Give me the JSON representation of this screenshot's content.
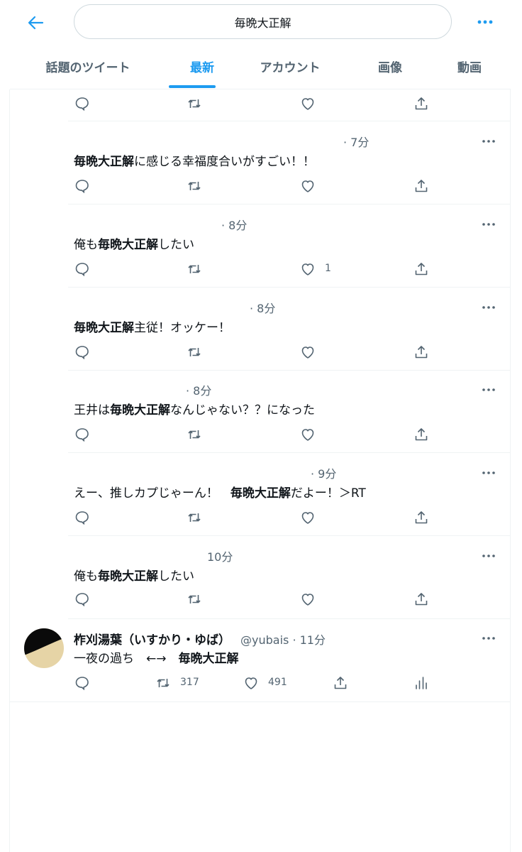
{
  "search": {
    "query": "毎晩大正解"
  },
  "tabs": [
    {
      "label": "話題のツイート"
    },
    {
      "label": "最新"
    },
    {
      "label": "アカウント"
    },
    {
      "label": "画像"
    },
    {
      "label": "動画"
    }
  ],
  "replies": [
    {
      "time": "· 7分",
      "text_bold": "毎晩大正解",
      "text_after": "に感じる幸福度合いがすごい！！"
    },
    {
      "time": "· 8分",
      "text_before": "俺も",
      "text_bold": "毎晩大正解",
      "text_after": "したい",
      "like_count": "1"
    },
    {
      "time": "· 8分",
      "text_bold": "毎晩大正解",
      "text_after": "主従！オッケー！"
    },
    {
      "time": "· 8分",
      "text_before": "王井は",
      "text_bold": "毎晩大正解",
      "text_after": "なんじゃない？？になった"
    },
    {
      "time": "· 9分",
      "text_before": "えー、推しカプじゃーん！　",
      "text_bold": "毎晩大正解",
      "text_after": "だよー！＞RT"
    },
    {
      "time": "10分",
      "text_before": "俺も",
      "text_bold": "毎晩大正解",
      "text_after": "したい"
    }
  ],
  "main_tweet": {
    "name": "柞刈湯葉（いすかり・ゆば）",
    "handle": "@yubais · 11分",
    "text_before": "一夜の過ち　←→　",
    "text_bold": "毎晩大正解",
    "retweet_count": "317",
    "like_count": "491"
  },
  "colors": {
    "accent": "#1d9bf0",
    "secondary_text": "#536471",
    "divider": "#eff3f4"
  }
}
